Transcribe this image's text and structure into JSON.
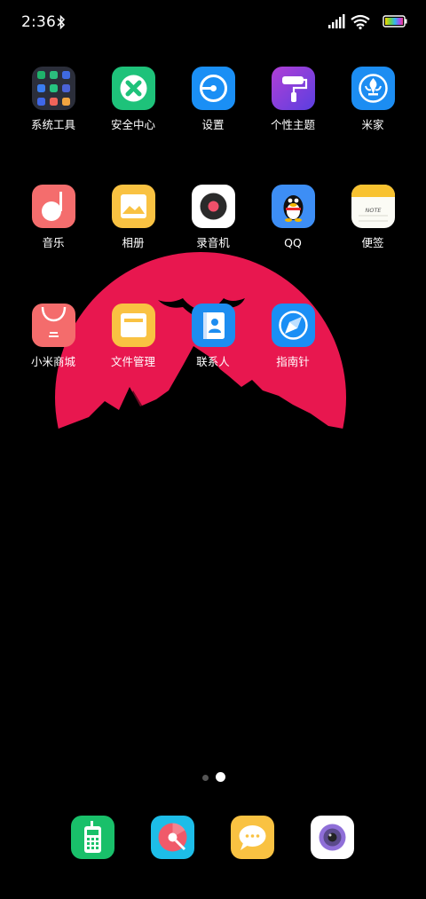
{
  "status_bar": {
    "time": "2:36",
    "icons": [
      "bluetooth-icon",
      "signal-icon",
      "wifi-icon",
      "battery-icon"
    ]
  },
  "colors": {
    "moon": "#E8174F",
    "background": "#000000"
  },
  "apps": [
    {
      "label": "系统工具",
      "icon": "folder-icon"
    },
    {
      "label": "安全中心",
      "icon": "security-icon"
    },
    {
      "label": "设置",
      "icon": "settings-icon"
    },
    {
      "label": "个性主题",
      "icon": "theme-roller-icon"
    },
    {
      "label": "米家",
      "icon": "mijia-icon"
    },
    {
      "label": "音乐",
      "icon": "music-icon"
    },
    {
      "label": "相册",
      "icon": "gallery-icon"
    },
    {
      "label": "录音机",
      "icon": "recorder-icon"
    },
    {
      "label": "QQ",
      "icon": "qq-penguin-icon"
    },
    {
      "label": "便签",
      "icon": "notes-icon",
      "badge": "NOTE"
    },
    {
      "label": "小米商城",
      "icon": "mi-store-icon"
    },
    {
      "label": "文件管理",
      "icon": "file-manager-icon"
    },
    {
      "label": "联系人",
      "icon": "contacts-icon"
    },
    {
      "label": "指南针",
      "icon": "compass-icon"
    }
  ],
  "page_indicator": {
    "pages": 2,
    "current": 2
  },
  "dock": [
    {
      "icon": "phone-icon"
    },
    {
      "icon": "browser-icon"
    },
    {
      "icon": "messages-icon"
    },
    {
      "icon": "camera-icon"
    }
  ]
}
